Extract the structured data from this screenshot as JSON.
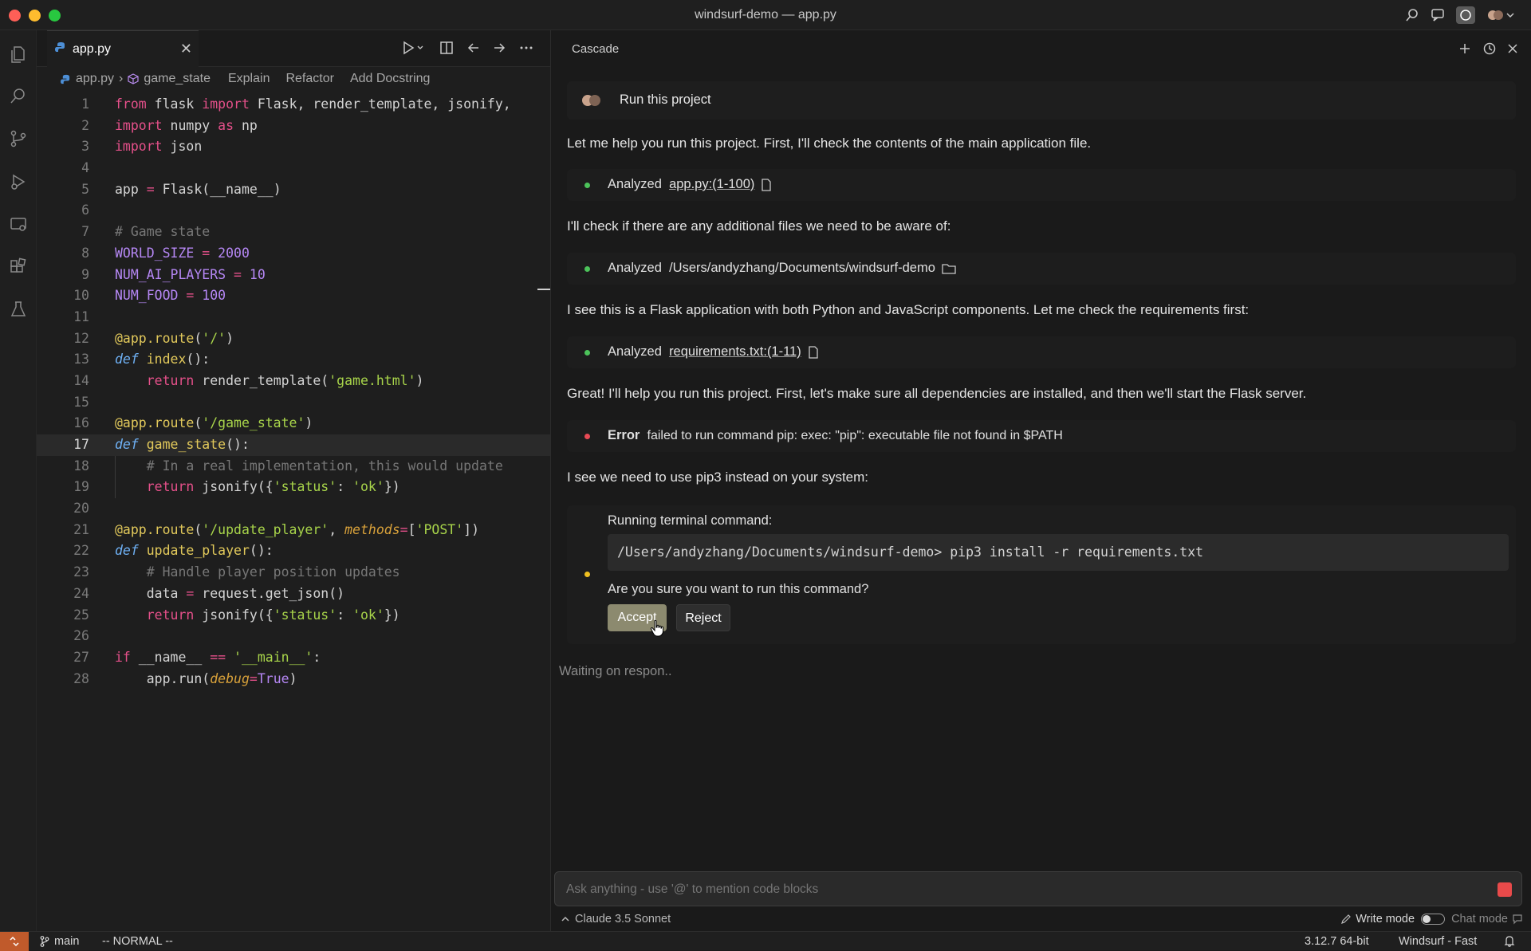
{
  "window": {
    "title": "windsurf-demo — app.py"
  },
  "editor": {
    "tab_label": "app.py",
    "breadcrumb": {
      "file": "app.py",
      "symbol": "game_state",
      "lens": [
        "Explain",
        "Refactor",
        "Add Docstring"
      ]
    },
    "lines": [
      "from flask import Flask, render_template, jsonify,",
      "import numpy as np",
      "import json",
      "",
      "app = Flask(__name__)",
      "",
      "# Game state",
      "WORLD_SIZE = 2000",
      "NUM_AI_PLAYERS = 10",
      "NUM_FOOD = 100",
      "",
      "@app.route('/')",
      "def index():",
      "    return render_template('game.html')",
      "",
      "@app.route('/game_state')",
      "def game_state():",
      "    # In a real implementation, this would update",
      "    return jsonify({'status': 'ok'})",
      "",
      "@app.route('/update_player', methods=['POST'])",
      "def update_player():",
      "    # Handle player position updates",
      "    data = request.get_json()",
      "    return jsonify({'status': 'ok'})",
      "",
      "if __name__ == '__main__':",
      "    app.run(debug=True)"
    ],
    "line_numbers": [
      "1",
      "2",
      "3",
      "4",
      "5",
      "6",
      "7",
      "8",
      "9",
      "10",
      "11",
      "12",
      "13",
      "14",
      "15",
      "16",
      "17",
      "18",
      "19",
      "20",
      "21",
      "22",
      "23",
      "24",
      "25",
      "26",
      "27",
      "28"
    ],
    "current_line": 17
  },
  "cascade": {
    "title": "Cascade",
    "user_message": "Run this project",
    "messages": [
      "Let me help you run this project. First, I'll check the contents of the main application file.",
      "I'll check if there are any additional files we need to be aware of:",
      "I see this is a Flask application with both Python and JavaScript components. Let me check the requirements first:",
      "Great! I'll help you run this project. First, let's make sure all dependencies are installed, and then we'll start the Flask server.",
      "I see we need to use pip3 instead on your system:"
    ],
    "steps": [
      {
        "label": "Analyzed",
        "target": "app.py:(1-100)"
      },
      {
        "label": "Analyzed",
        "target": "/Users/andyzhang/Documents/windsurf-demo"
      },
      {
        "label": "Analyzed",
        "target": "requirements.txt:(1-11)"
      },
      {
        "label": "Error",
        "target": "failed to run command pip: exec: \"pip\": executable file not found in $PATH"
      }
    ],
    "command": {
      "label": "Running terminal command:",
      "code": "/Users/andyzhang/Documents/windsurf-demo> pip3 install -r requirements.txt",
      "question": "Are you sure you want to run this command?",
      "accept_label": "Accept",
      "reject_label": "Reject"
    },
    "waiting": "Waiting on respon..",
    "input_placeholder": "Ask anything - use '@' to mention code blocks",
    "model": "Claude 3.5 Sonnet",
    "write_mode": "Write mode",
    "chat_mode": "Chat mode"
  },
  "statusbar": {
    "branch": "main",
    "vim_mode": "-- NORMAL --",
    "python": "3.12.7 64-bit",
    "windsurf": "Windsurf - Fast"
  },
  "colors": {
    "accent": "#c05a2b",
    "accept": "#8c8a6f",
    "error_dot": "#e84a55",
    "ok_dot": "#4cc35a",
    "pending_dot": "#f0c020"
  }
}
